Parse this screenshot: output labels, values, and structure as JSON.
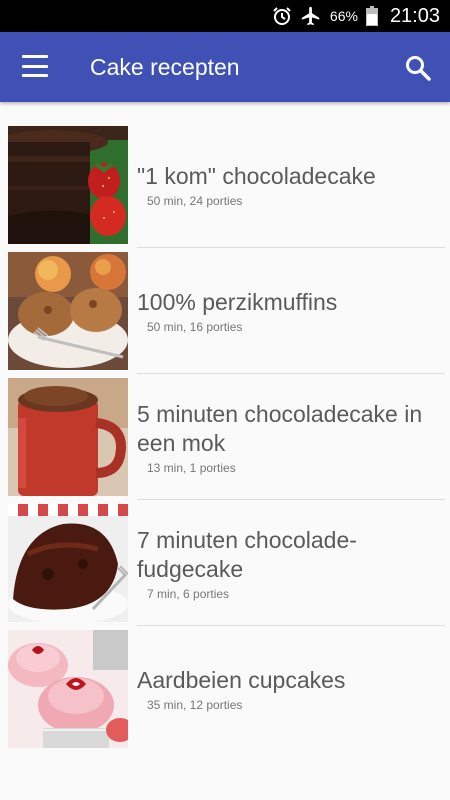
{
  "status": {
    "battery_pct": "66%",
    "time": "21:03"
  },
  "app_bar": {
    "title": "Cake recepten"
  },
  "recipes": [
    {
      "name": "\"1 kom\" chocoladecake",
      "meta": "50 min, 24 porties"
    },
    {
      "name": "100% perzikmuffins",
      "meta": "50 min, 16 porties"
    },
    {
      "name": "5 minuten chocoladecake in een mok",
      "meta": "13 min, 1 porties"
    },
    {
      "name": "7 minuten chocolade-fudgecake",
      "meta": "7 min, 6 porties"
    },
    {
      "name": "Aardbeien cupcakes",
      "meta": "35 min, 12 porties"
    }
  ]
}
